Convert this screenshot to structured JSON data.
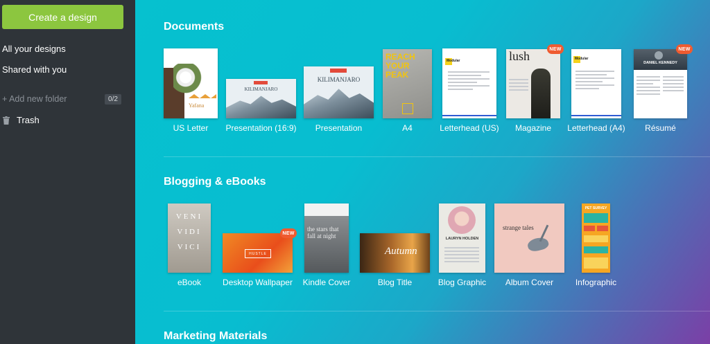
{
  "sidebar": {
    "create_label": "Create a design",
    "all_designs": "All your designs",
    "shared": "Shared with you",
    "add_folder": "+ Add new folder",
    "folder_count": "0/2",
    "trash": "Trash"
  },
  "sections": {
    "documents": "Documents",
    "blogging": "Blogging & eBooks",
    "marketing": "Marketing Materials"
  },
  "badge_text": "NEW",
  "documents": [
    {
      "label": "US Letter",
      "thumb_text": "Yafana"
    },
    {
      "label": "Presentation (16:9)",
      "thumb_text": "KILIMANJARO"
    },
    {
      "label": "Presentation",
      "thumb_text": "KILIMANJARO"
    },
    {
      "label": "A4",
      "thumb_text": "REACH YOUR PEAK"
    },
    {
      "label": "Letterhead (US)",
      "thumb_text": "Modular"
    },
    {
      "label": "Magazine",
      "thumb_text": "lush"
    },
    {
      "label": "Letterhead (A4)",
      "thumb_text": "Modular"
    },
    {
      "label": "Résumé",
      "thumb_text": "DANIEL KENNEDY"
    }
  ],
  "blogging": [
    {
      "label": "eBook",
      "thumb_text": "VENI VIDI VICI"
    },
    {
      "label": "Desktop Wallpaper",
      "thumb_text": "HUSTLE"
    },
    {
      "label": "Kindle Cover",
      "thumb_text": "the stars that fall at night"
    },
    {
      "label": "Blog Title",
      "thumb_text": "Autumn"
    },
    {
      "label": "Blog Graphic",
      "thumb_text": "LAURYN HOLDEN"
    },
    {
      "label": "Album Cover",
      "thumb_text": "strange tales"
    },
    {
      "label": "Infographic",
      "thumb_text": "PET SURVEY"
    }
  ],
  "colors": {
    "accent_green": "#8cc63f",
    "badge_orange": "#ef5b30",
    "sidebar_bg": "#2f3439"
  }
}
